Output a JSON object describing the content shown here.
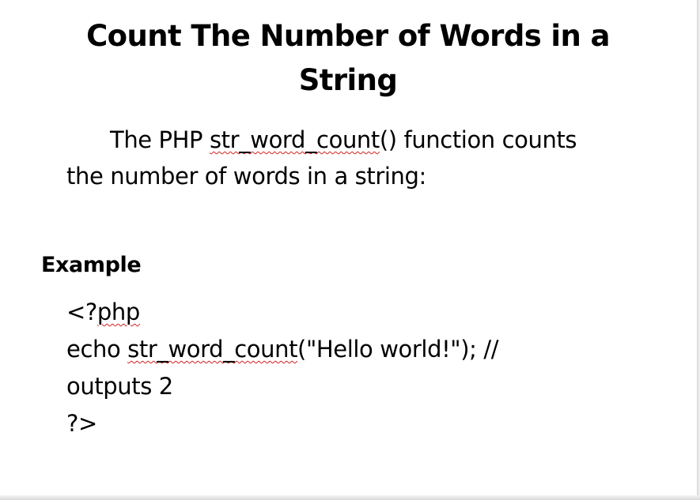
{
  "slide": {
    "title_line1": "Count The Number of Words in a",
    "title_line2": "String",
    "intro": {
      "line1_before": "The PHP ",
      "line1_function": "str_word_count",
      "line1_after": "() function counts",
      "line2": "the number of words in a string:"
    },
    "example_heading": "Example",
    "code": {
      "line1_prefix": "<?",
      "line1_keyword": "php",
      "line2_prefix": "echo ",
      "line2_function": "str_word_count",
      "line2_suffix": "(\"Hello world!\"); //",
      "line3": "outputs 2",
      "line4": "?>"
    }
  }
}
